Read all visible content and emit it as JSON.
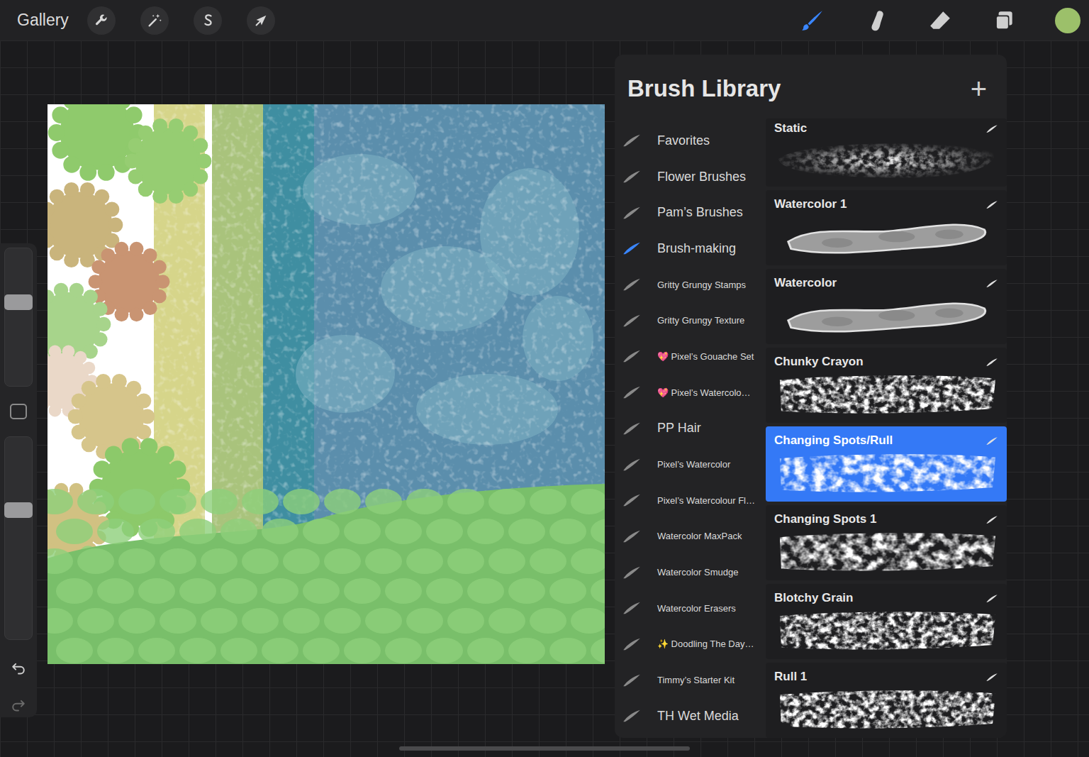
{
  "topbar": {
    "gallery": "Gallery",
    "actions": [
      {
        "kind": "wrench"
      },
      {
        "kind": "wand"
      },
      {
        "kind": "selection"
      },
      {
        "kind": "transform"
      }
    ],
    "tools": [
      {
        "kind": "brush",
        "selected": true
      },
      {
        "kind": "smudge",
        "selected": false
      },
      {
        "kind": "eraser",
        "selected": false
      },
      {
        "kind": "layers",
        "selected": false
      }
    ],
    "color": "#9cc06a"
  },
  "sidebar": {
    "size_level": 0.62,
    "opacity_level": 0.65
  },
  "brush_library": {
    "title": "Brush Library",
    "add": "+",
    "sets": [
      {
        "label": "Favorites",
        "selected": false
      },
      {
        "label": "Flower Brushes",
        "selected": false
      },
      {
        "label": "Pam’s Brushes",
        "selected": false
      },
      {
        "label": "Brush-making",
        "selected": true
      },
      {
        "label": "Gritty Grungy Stamps",
        "selected": false
      },
      {
        "label": "Gritty Grungy Texture",
        "selected": false
      },
      {
        "label": "💖 Pixel’s Gouache Set",
        "selected": false
      },
      {
        "label": "💖 Pixel’s Watercolo…",
        "selected": false
      },
      {
        "label": "PP Hair",
        "selected": false
      },
      {
        "label": "Pixel’s Watercolor",
        "selected": false
      },
      {
        "label": "Pixel’s Watercolour Fl…",
        "selected": false
      },
      {
        "label": "Watercolor MaxPack",
        "selected": false
      },
      {
        "label": "Watercolor Smudge",
        "selected": false
      },
      {
        "label": "Watercolor Erasers",
        "selected": false
      },
      {
        "label": "✨ Doodling The Day…",
        "selected": false
      },
      {
        "label": "Timmy’s Starter Kit",
        "selected": false
      },
      {
        "label": "TH Wet Media",
        "selected": false
      }
    ],
    "brushes": [
      {
        "name": "Static",
        "kind": "speckle",
        "selected": false
      },
      {
        "name": "Watercolor 1",
        "kind": "watercolor",
        "selected": false
      },
      {
        "name": "Watercolor",
        "kind": "watercolor",
        "selected": false
      },
      {
        "name": "Chunky Crayon",
        "kind": "rough",
        "selected": false
      },
      {
        "name": "Changing Spots/Rull",
        "kind": "spots",
        "selected": true
      },
      {
        "name": "Changing Spots 1",
        "kind": "spots",
        "selected": false
      },
      {
        "name": "Blotchy Grain",
        "kind": "rough",
        "selected": false
      },
      {
        "name": "Rull 1",
        "kind": "rough",
        "selected": false
      }
    ]
  }
}
